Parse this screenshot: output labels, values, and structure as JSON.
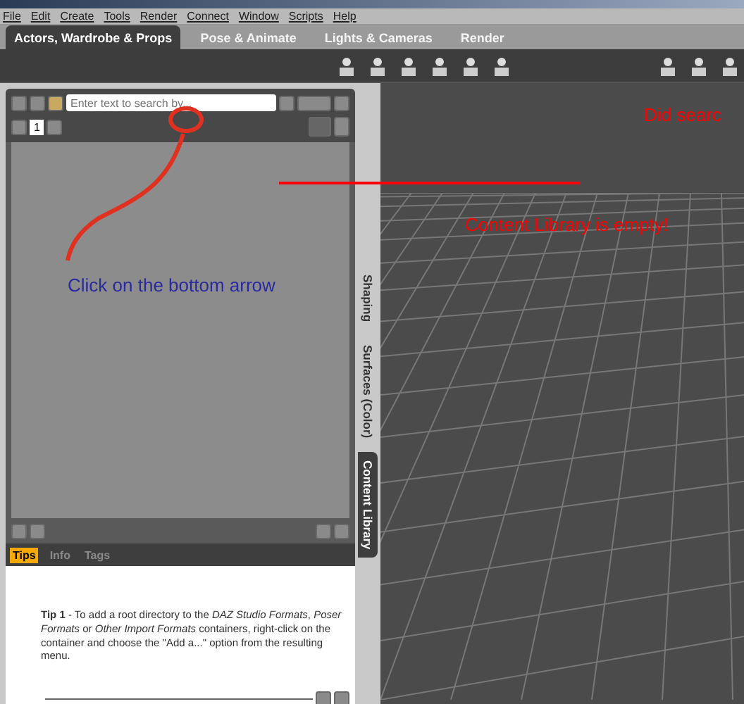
{
  "menu": [
    "File",
    "Edit",
    "Create",
    "Tools",
    "Render",
    "Connect",
    "Window",
    "Scripts",
    "Help"
  ],
  "tabs": [
    {
      "label": "Actors, Wardrobe & Props",
      "selected": true
    },
    {
      "label": "Pose & Animate",
      "selected": false
    },
    {
      "label": "Lights & Cameras",
      "selected": false
    },
    {
      "label": "Render",
      "selected": false
    }
  ],
  "search": {
    "placeholder": "Enter text to search by..."
  },
  "page": {
    "number": "1"
  },
  "side_tabs": [
    {
      "label": "Shaping",
      "selected": false
    },
    {
      "label": "Surfaces (Color)",
      "selected": false
    },
    {
      "label": "Content Library",
      "selected": true
    }
  ],
  "info_tabs": [
    {
      "label": "Tips",
      "selected": true
    },
    {
      "label": "Info",
      "selected": false
    },
    {
      "label": "Tags",
      "selected": false
    }
  ],
  "tip": "**Tip 1** - To add a root directory to the *DAZ Studio Formats*, *Poser Formats* or *Other Import Formats* containers, right-click on the container and choose the \"Add a...\" option from the resulting menu.",
  "annotations": [
    {
      "text": "Did searc",
      "color": "#ff0000"
    },
    {
      "text": "Content Library is empty!",
      "color": "#ff0000"
    },
    {
      "text": "Click on the bottom arrow",
      "color": "#2a2aa0"
    }
  ]
}
